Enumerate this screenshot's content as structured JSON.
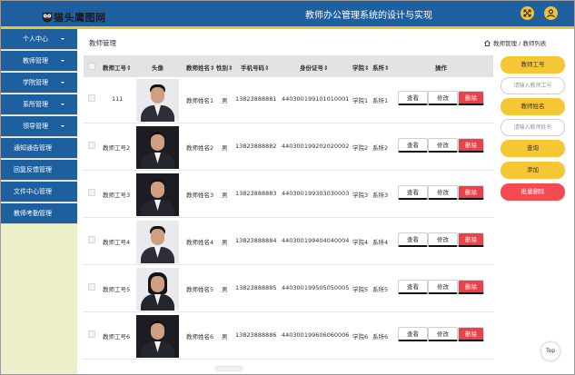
{
  "header": {
    "logo_text": "猫头鹰图网",
    "title": "教师办公管理系统的设计与实现",
    "fullscreen_icon": "expand-arrows-icon",
    "user_icon": "user-icon",
    "color": "#1e5f9f",
    "accent": "#f3c32c"
  },
  "sidebar": {
    "items": [
      {
        "label": "个人中心",
        "has_caret": true
      },
      {
        "label": "教师管理",
        "has_caret": true
      },
      {
        "label": "学院管理",
        "has_caret": true
      },
      {
        "label": "系所管理",
        "has_caret": true
      },
      {
        "label": "领导管理",
        "has_caret": true
      },
      {
        "label": "通知通告管理",
        "has_caret": false
      },
      {
        "label": "回复反馈管理",
        "has_caret": false
      },
      {
        "label": "文件中心管理",
        "has_caret": false
      },
      {
        "label": "教师考勤管理",
        "has_caret": false
      }
    ]
  },
  "page": {
    "title": "教师管理",
    "breadcrumb": [
      "教师管理",
      "教师列表"
    ],
    "breadcrumb_separator": "/"
  },
  "table": {
    "columns": [
      "教师工号",
      "头像",
      "教师姓名",
      "性别",
      "手机号码",
      "身份证号",
      "学院",
      "系所",
      "操作"
    ],
    "sortable": [
      true,
      false,
      true,
      true,
      true,
      true,
      true,
      true,
      false
    ],
    "rows": [
      {
        "id": "111",
        "avatar": "male-teacher-photo",
        "name": "教师姓名1",
        "gender": "男",
        "phone": "13823888881",
        "idcard": "440300199101010001",
        "college": "学院1",
        "dept": "系所1"
      },
      {
        "id": "教师工号2",
        "avatar": "male-teacher-photo",
        "name": "教师姓名2",
        "gender": "男",
        "phone": "13823888882",
        "idcard": "440300199202020002",
        "college": "学院2",
        "dept": "系所2"
      },
      {
        "id": "教师工号3",
        "avatar": "male-teacher-photo",
        "name": "教师姓名3",
        "gender": "男",
        "phone": "13823888883",
        "idcard": "440300199303030003",
        "college": "学院3",
        "dept": "系所3"
      },
      {
        "id": "教师工号4",
        "avatar": "male-teacher-photo",
        "name": "教师姓名4",
        "gender": "男",
        "phone": "13823888884",
        "idcard": "440300199404040004",
        "college": "学院4",
        "dept": "系所4"
      },
      {
        "id": "教师工号5",
        "avatar": "female-teacher-photo",
        "name": "教师姓名5",
        "gender": "男",
        "phone": "13823888885",
        "idcard": "440300199505050005",
        "college": "学院5",
        "dept": "系所5"
      },
      {
        "id": "教师工号6",
        "avatar": "male-teacher-photo",
        "name": "教师姓名6",
        "gender": "男",
        "phone": "13823888886",
        "idcard": "440300199606060006",
        "college": "学院6",
        "dept": "系所6"
      }
    ],
    "actions": {
      "view": "查看",
      "edit": "修改",
      "delete": "删除"
    }
  },
  "search_panel": {
    "id_label": "教师工号",
    "id_placeholder": "请输入教师工号",
    "name_label": "教师姓名",
    "name_placeholder": "请输入教师姓名",
    "query_label": "查询",
    "add_label": "添加",
    "batch_delete_label": "批量删除"
  },
  "back_to_top": "Top",
  "colors": {
    "primary": "#1e5f9f",
    "yellow": "#f6c734",
    "red": "#ef3f47",
    "sidebar_bg": "#edefca"
  }
}
